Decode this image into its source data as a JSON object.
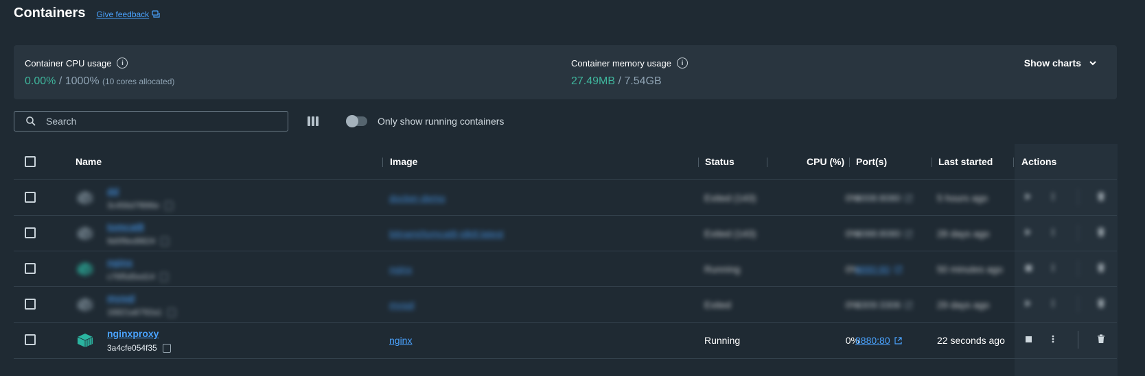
{
  "header": {
    "title": "Containers",
    "feedback_link": "Give feedback"
  },
  "usage": {
    "cpu": {
      "label": "Container CPU usage",
      "used": "0.00%",
      "sep": " / ",
      "total": "1000%",
      "note": "(10 cores allocated)"
    },
    "memory": {
      "label": "Container memory usage",
      "used": "27.49MB",
      "sep": " / ",
      "total": "7.54GB"
    },
    "show_charts": "Show charts"
  },
  "toolbar": {
    "search_placeholder": "Search",
    "toggle_label": "Only show running containers",
    "toggle_on": false
  },
  "table": {
    "columns": {
      "name": "Name",
      "image": "Image",
      "status": "Status",
      "cpu": "CPU (%)",
      "ports": "Port(s)",
      "last_started": "Last started",
      "actions": "Actions"
    },
    "rows": [
      {
        "name": "dd",
        "id": "3c456d7f896e",
        "image": "docker-demo",
        "status": "Exited (143)",
        "cpu": "0%",
        "port": "8008:8080",
        "port_link": false,
        "last_started": "5 hours ago",
        "running": false,
        "blurred": true
      },
      {
        "name": "tomcat8",
        "id": "9d0f9ed9824",
        "image": "bitnami/tomcat8-jdk8:latest",
        "status": "Exited (143)",
        "cpu": "0%",
        "port": "8088:8080",
        "port_link": false,
        "last_started": "28 days ago",
        "running": false,
        "blurred": true
      },
      {
        "name": "nginx",
        "id": "c76f5d5ed14",
        "image": "nginx",
        "status": "Running",
        "cpu": "0%",
        "port": "8880:80",
        "port_link": true,
        "last_started": "50 minutes ago",
        "running": true,
        "blurred": true
      },
      {
        "name": "mysql",
        "id": "16821a6792a1",
        "image": "mysql",
        "status": "Exited",
        "cpu": "0%",
        "port": "3309:3306",
        "port_link": false,
        "last_started": "29 days ago",
        "running": false,
        "blurred": true
      },
      {
        "name": "nginxproxy",
        "id": "3a4cfe054f35",
        "image": "nginx",
        "status": "Running",
        "cpu": "0%",
        "port": "8880:80",
        "port_link": true,
        "last_started": "22 seconds ago",
        "running": true,
        "blurred": false
      }
    ]
  },
  "colors": {
    "accent_link": "#4aa3ff",
    "usage_green": "#3fb59c",
    "running_container_icon": "#2bb4a0",
    "stopped_container_icon": "#7e8e99"
  },
  "icons": {
    "feedback": "chat-bubble-icon",
    "info": "info-icon",
    "chevron": "chevron-down-icon",
    "search": "search-icon",
    "columns": "columns-icon",
    "copy": "copy-icon",
    "external": "external-link-icon",
    "stop": "stop-icon",
    "start": "play-icon",
    "more": "more-vertical-icon",
    "delete": "trash-icon"
  }
}
